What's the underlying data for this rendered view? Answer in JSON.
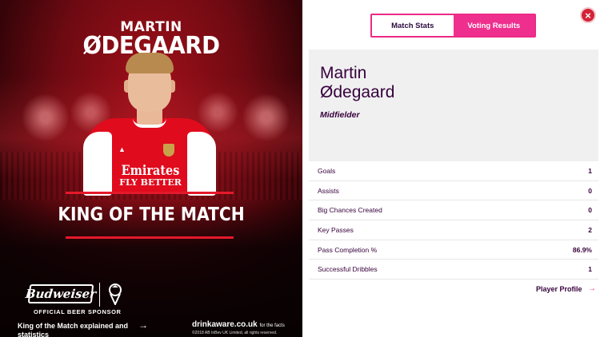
{
  "promo": {
    "first_name": "MARTIN",
    "last_name": "ØDEGAARD",
    "shirt_sponsor_line1": "Emirates",
    "shirt_sponsor_line2": "FLY BETTER",
    "title": "KING OF THE MATCH",
    "sponsor_logo_text": "Budweiser",
    "sponsor_label": "OFFICIAL BEER SPONSOR",
    "explained_link": "King of the Match explained and statistics",
    "drinkaware": "drinkaware.co.uk",
    "drinkaware_suffix": "for the facts",
    "copyright": "©2018 AB InBev UK Limited, all rights reserved."
  },
  "tabs": [
    {
      "label": "Match Stats",
      "active": false
    },
    {
      "label": "Voting Results",
      "active": true
    }
  ],
  "close_label": "×",
  "player_card": {
    "first_name": "Martin",
    "last_name": "Ødegaard",
    "position": "Midfielder"
  },
  "stats": [
    {
      "label": "Goals",
      "value": "1"
    },
    {
      "label": "Assists",
      "value": "0"
    },
    {
      "label": "Big Chances Created",
      "value": "0"
    },
    {
      "label": "Key Passes",
      "value": "2"
    },
    {
      "label": "Pass Completion %",
      "value": "86.9%"
    },
    {
      "label": "Successful Dribbles",
      "value": "1"
    }
  ],
  "profile_link": "Player Profile",
  "colors": {
    "accent_pink": "#ef2f8e",
    "deep_purple": "#37003c",
    "arsenal_red": "#e00b1d",
    "close_red": "#d42236"
  }
}
